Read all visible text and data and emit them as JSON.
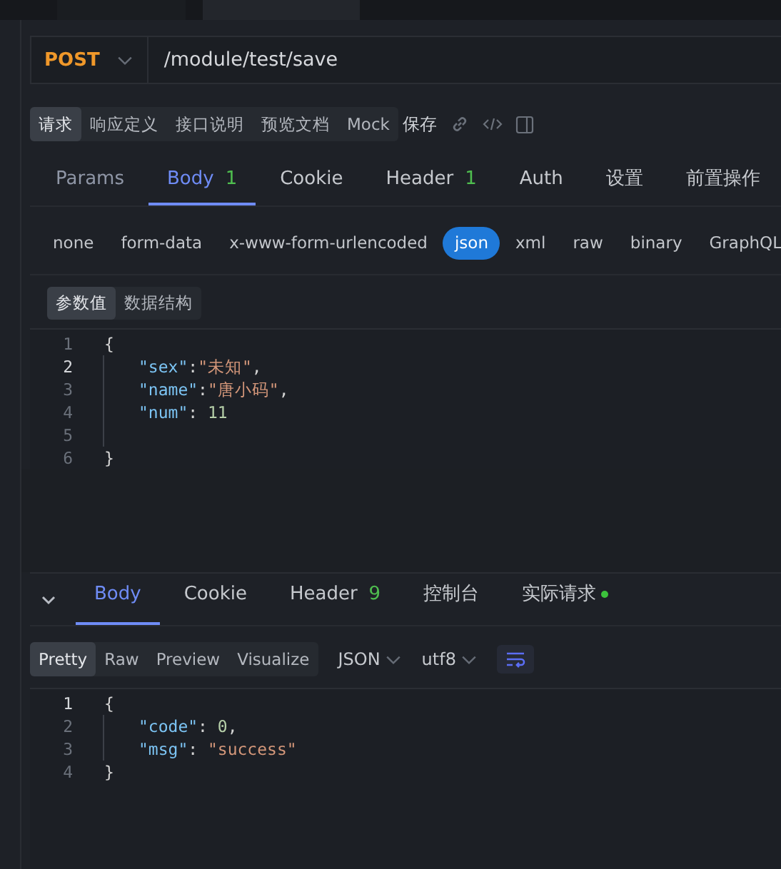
{
  "url_bar": {
    "method": "POST",
    "url": "/module/test/save"
  },
  "request_tabs": [
    {
      "label": "请求",
      "selected": true
    },
    {
      "label": "响应定义",
      "selected": false
    },
    {
      "label": "接口说明",
      "selected": false
    },
    {
      "label": "预览文档",
      "selected": false
    },
    {
      "label": "Mock",
      "selected": false
    }
  ],
  "save_label": "保存",
  "param_tabs": [
    {
      "label": "Params",
      "selected": false
    },
    {
      "label": "Body",
      "count": "1",
      "selected": true
    },
    {
      "label": "Cookie",
      "selected": false
    },
    {
      "label": "Header",
      "count": "1",
      "selected": false
    },
    {
      "label": "Auth",
      "selected": false
    },
    {
      "label": "设置",
      "selected": false
    },
    {
      "label": "前置操作",
      "selected": false
    }
  ],
  "body_types": [
    {
      "label": "none",
      "selected": false
    },
    {
      "label": "form-data",
      "selected": false
    },
    {
      "label": "x-www-form-urlencoded",
      "selected": false
    },
    {
      "label": "json",
      "selected": true
    },
    {
      "label": "xml",
      "selected": false
    },
    {
      "label": "raw",
      "selected": false
    },
    {
      "label": "binary",
      "selected": false
    },
    {
      "label": "GraphQL",
      "selected": false
    }
  ],
  "editor_tabs": [
    {
      "label": "参数值",
      "selected": true
    },
    {
      "label": "数据结构",
      "selected": false
    }
  ],
  "request_code": [
    {
      "number": "1",
      "active": false,
      "indented": false,
      "tokens": [
        {
          "kind": "punct",
          "text": "{"
        }
      ]
    },
    {
      "number": "2",
      "active": true,
      "indented": true,
      "tokens": [
        {
          "kind": "key",
          "text": "\"sex\""
        },
        {
          "kind": "punct",
          "text": ":"
        },
        {
          "kind": "string",
          "text": "\"未知\""
        },
        {
          "kind": "punct",
          "text": ","
        }
      ]
    },
    {
      "number": "3",
      "active": false,
      "indented": true,
      "tokens": [
        {
          "kind": "key",
          "text": "\"name\""
        },
        {
          "kind": "punct",
          "text": ":"
        },
        {
          "kind": "string",
          "text": "\"唐小码\""
        },
        {
          "kind": "punct",
          "text": ","
        }
      ]
    },
    {
      "number": "4",
      "active": false,
      "indented": true,
      "tokens": [
        {
          "kind": "key",
          "text": "\"num\""
        },
        {
          "kind": "punct",
          "text": ": "
        },
        {
          "kind": "number",
          "text": "11"
        }
      ]
    },
    {
      "number": "5",
      "active": false,
      "indented": true
    },
    {
      "number": "6",
      "active": false,
      "indented": false,
      "tokens": [
        {
          "kind": "punct",
          "text": "}"
        }
      ]
    }
  ],
  "response_tabs": [
    {
      "label": "Body",
      "selected": true
    },
    {
      "label": "Cookie",
      "selected": false
    },
    {
      "label": "Header",
      "count": "9",
      "selected": false
    },
    {
      "label": "控制台",
      "selected": false
    },
    {
      "label": "实际请求",
      "dot": true,
      "selected": false
    }
  ],
  "view_modes": [
    {
      "label": "Pretty",
      "selected": true
    },
    {
      "label": "Raw",
      "selected": false
    },
    {
      "label": "Preview",
      "selected": false
    },
    {
      "label": "Visualize",
      "selected": false
    }
  ],
  "format": "JSON",
  "encoding": "utf8",
  "response_code": [
    {
      "number": "1",
      "active": true,
      "indented": false,
      "tokens": [
        {
          "kind": "punct",
          "text": "{"
        }
      ]
    },
    {
      "number": "2",
      "active": false,
      "indented": true,
      "tokens": [
        {
          "kind": "key",
          "text": "\"code\""
        },
        {
          "kind": "punct",
          "text": ": "
        },
        {
          "kind": "number",
          "text": "0"
        },
        {
          "kind": "punct",
          "text": ","
        }
      ]
    },
    {
      "number": "3",
      "active": false,
      "indented": true,
      "tokens": [
        {
          "kind": "key",
          "text": "\"msg\""
        },
        {
          "kind": "punct",
          "text": ": "
        },
        {
          "kind": "string",
          "text": "\"success\""
        }
      ]
    },
    {
      "number": "4",
      "active": false,
      "indented": false,
      "tokens": [
        {
          "kind": "punct",
          "text": "}"
        }
      ]
    }
  ]
}
